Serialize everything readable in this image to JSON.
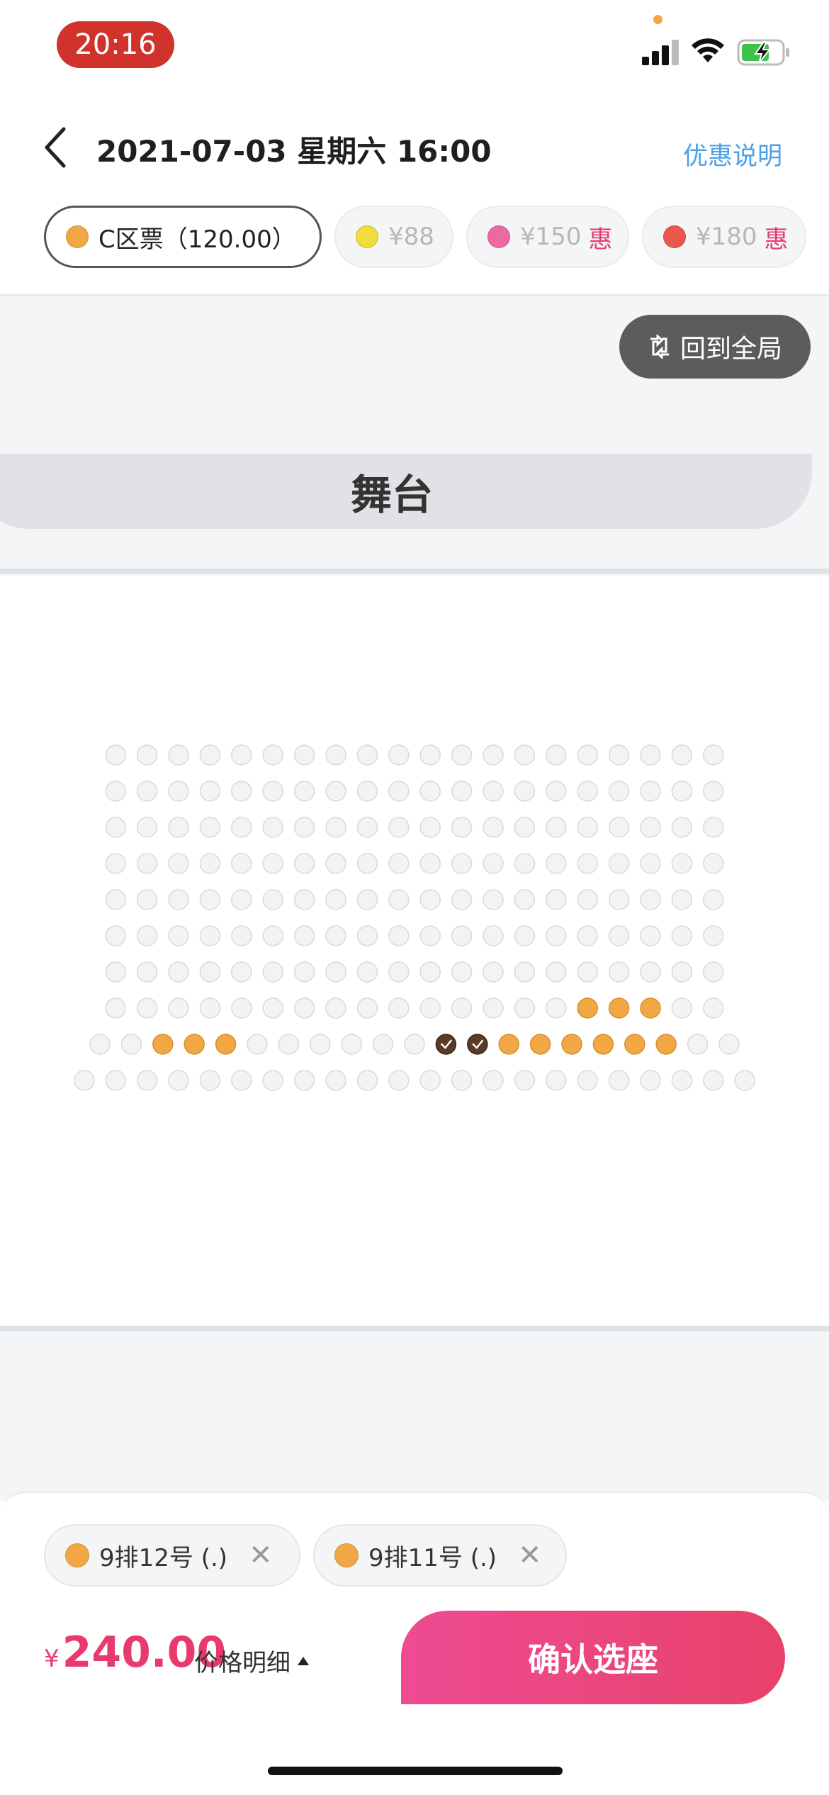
{
  "status_bar": {
    "time": "20:16"
  },
  "header": {
    "title": "2021-07-03 星期六 16:00",
    "promo_link": "优惠说明"
  },
  "ticket_tabs": [
    {
      "label": "C区票（120.00）",
      "color": "#f2a745",
      "active": true,
      "hui": ""
    },
    {
      "label": "¥88",
      "color": "#f0dc3c",
      "active": false,
      "hui": ""
    },
    {
      "label": "¥150",
      "color": "#ec6aa1",
      "active": false,
      "hui": "惠"
    },
    {
      "label": "¥180",
      "color": "#e9574e",
      "active": false,
      "hui": "惠"
    }
  ],
  "map": {
    "back_to_global": "回到全局",
    "stage_label": "舞台",
    "seats": {
      "legend": {
        "empty": "#f3f3f3",
        "available": "#f2a745",
        "selected": "#5a3b26"
      },
      "rows": [
        "EEEEEEEEEEEEEEEEEEEE",
        "EEEEEEEEEEEEEEEEEEEE",
        "EEEEEEEEEEEEEEEEEEEE",
        "EEEEEEEEEEEEEEEEEEEE",
        "EEEEEEEEEEEEEEEEEEEE",
        "EEEEEEEEEEEEEEEEEEEE",
        "EEEEEEEEEEEEEEEEEEEE",
        "EEEEEEEEEEEEEEEAAAEE",
        "EEAAAEEEEEESSAAAAAAEE",
        "EEEEEEEEEEEEEEEEEEEEEE"
      ]
    }
  },
  "selected_seats": [
    {
      "label": "9排12号 (.)",
      "color": "#f2a745"
    },
    {
      "label": "9排11号 (.)",
      "color": "#f2a745"
    }
  ],
  "footer": {
    "currency": "¥",
    "total": "240.00",
    "price_detail": "价格明细",
    "confirm_button": "确认选座"
  }
}
